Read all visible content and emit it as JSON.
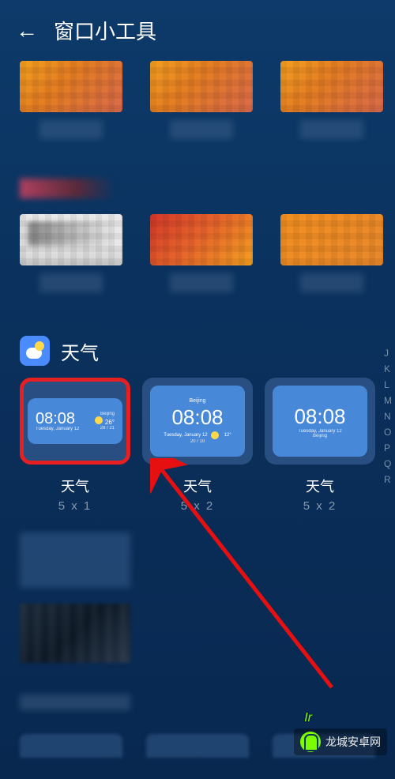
{
  "header": {
    "title": "窗口小工具"
  },
  "weather_section": {
    "title": "天气"
  },
  "widgets": [
    {
      "label": "天气",
      "size": "5 x 1",
      "time": "08:08",
      "date": "Tuesday, January 12",
      "location": "Beijing",
      "temp": "26°",
      "range": "28 / 21"
    },
    {
      "label": "天气",
      "size": "5 x 2",
      "time": "08:08",
      "date": "Tuesday, January 12",
      "location": "Beijing",
      "temp": "12°",
      "range": "20 / 10"
    },
    {
      "label": "天气",
      "size": "5 x 2",
      "time": "08:08",
      "date": "Tuesday, January 12",
      "location": "Beijing"
    }
  ],
  "index_letters": [
    "J",
    "K",
    "L",
    "M",
    "N",
    "O",
    "P",
    "Q",
    "R"
  ],
  "watermark": "龙城安卓网",
  "green_note": "Ir"
}
